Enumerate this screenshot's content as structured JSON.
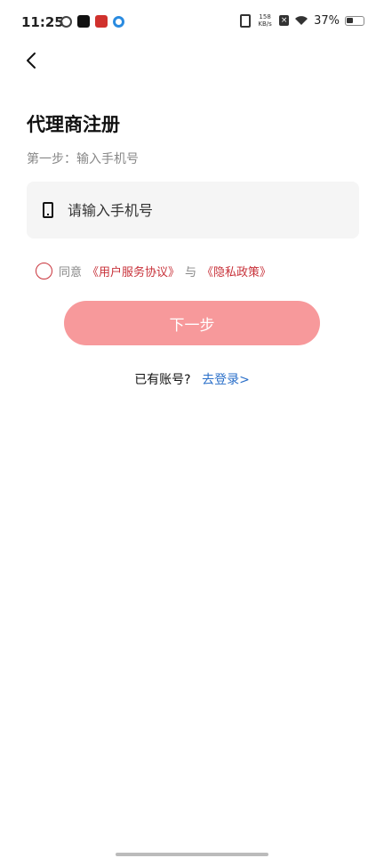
{
  "status_bar": {
    "time": "11:25",
    "net_speed_value": "158",
    "net_speed_unit": "KB/s",
    "battery_percent": "37%"
  },
  "header": {
    "title": "代理商注册",
    "step": "第一步：输入手机号"
  },
  "form": {
    "phone_placeholder": "请输入手机号"
  },
  "agreement": {
    "agree_label": "同意",
    "user_agreement": "《用户服务协议》",
    "and_label": "与",
    "privacy_policy": "《隐私政策》"
  },
  "actions": {
    "next_label": "下一步"
  },
  "login": {
    "have_account": "已有账号?",
    "go_login": "去登录>"
  },
  "colors": {
    "accent": "#c8323a",
    "button_bg": "#f7999b",
    "link_blue": "#2a6fc9"
  },
  "icons": {
    "back": "chevron-left-icon",
    "phone": "mobile-phone-icon"
  }
}
